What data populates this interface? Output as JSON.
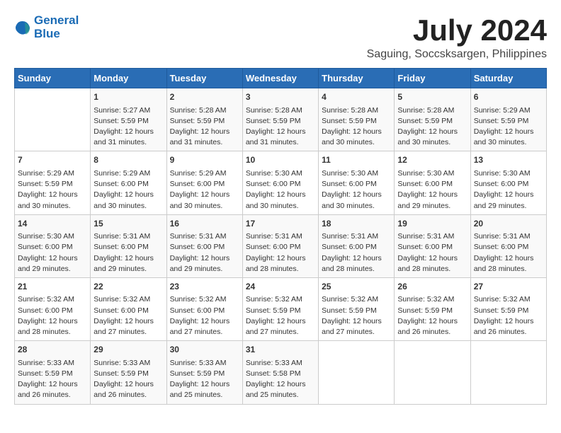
{
  "header": {
    "logo_line1": "General",
    "logo_line2": "Blue",
    "title": "July 2024",
    "location": "Saguing, Soccsksargen, Philippines"
  },
  "weekdays": [
    "Sunday",
    "Monday",
    "Tuesday",
    "Wednesday",
    "Thursday",
    "Friday",
    "Saturday"
  ],
  "weeks": [
    [
      {
        "day": "",
        "text": ""
      },
      {
        "day": "1",
        "text": "Sunrise: 5:27 AM\nSunset: 5:59 PM\nDaylight: 12 hours\nand 31 minutes."
      },
      {
        "day": "2",
        "text": "Sunrise: 5:28 AM\nSunset: 5:59 PM\nDaylight: 12 hours\nand 31 minutes."
      },
      {
        "day": "3",
        "text": "Sunrise: 5:28 AM\nSunset: 5:59 PM\nDaylight: 12 hours\nand 31 minutes."
      },
      {
        "day": "4",
        "text": "Sunrise: 5:28 AM\nSunset: 5:59 PM\nDaylight: 12 hours\nand 30 minutes."
      },
      {
        "day": "5",
        "text": "Sunrise: 5:28 AM\nSunset: 5:59 PM\nDaylight: 12 hours\nand 30 minutes."
      },
      {
        "day": "6",
        "text": "Sunrise: 5:29 AM\nSunset: 5:59 PM\nDaylight: 12 hours\nand 30 minutes."
      }
    ],
    [
      {
        "day": "7",
        "text": "Sunrise: 5:29 AM\nSunset: 5:59 PM\nDaylight: 12 hours\nand 30 minutes."
      },
      {
        "day": "8",
        "text": "Sunrise: 5:29 AM\nSunset: 6:00 PM\nDaylight: 12 hours\nand 30 minutes."
      },
      {
        "day": "9",
        "text": "Sunrise: 5:29 AM\nSunset: 6:00 PM\nDaylight: 12 hours\nand 30 minutes."
      },
      {
        "day": "10",
        "text": "Sunrise: 5:30 AM\nSunset: 6:00 PM\nDaylight: 12 hours\nand 30 minutes."
      },
      {
        "day": "11",
        "text": "Sunrise: 5:30 AM\nSunset: 6:00 PM\nDaylight: 12 hours\nand 30 minutes."
      },
      {
        "day": "12",
        "text": "Sunrise: 5:30 AM\nSunset: 6:00 PM\nDaylight: 12 hours\nand 29 minutes."
      },
      {
        "day": "13",
        "text": "Sunrise: 5:30 AM\nSunset: 6:00 PM\nDaylight: 12 hours\nand 29 minutes."
      }
    ],
    [
      {
        "day": "14",
        "text": "Sunrise: 5:30 AM\nSunset: 6:00 PM\nDaylight: 12 hours\nand 29 minutes."
      },
      {
        "day": "15",
        "text": "Sunrise: 5:31 AM\nSunset: 6:00 PM\nDaylight: 12 hours\nand 29 minutes."
      },
      {
        "day": "16",
        "text": "Sunrise: 5:31 AM\nSunset: 6:00 PM\nDaylight: 12 hours\nand 29 minutes."
      },
      {
        "day": "17",
        "text": "Sunrise: 5:31 AM\nSunset: 6:00 PM\nDaylight: 12 hours\nand 28 minutes."
      },
      {
        "day": "18",
        "text": "Sunrise: 5:31 AM\nSunset: 6:00 PM\nDaylight: 12 hours\nand 28 minutes."
      },
      {
        "day": "19",
        "text": "Sunrise: 5:31 AM\nSunset: 6:00 PM\nDaylight: 12 hours\nand 28 minutes."
      },
      {
        "day": "20",
        "text": "Sunrise: 5:31 AM\nSunset: 6:00 PM\nDaylight: 12 hours\nand 28 minutes."
      }
    ],
    [
      {
        "day": "21",
        "text": "Sunrise: 5:32 AM\nSunset: 6:00 PM\nDaylight: 12 hours\nand 28 minutes."
      },
      {
        "day": "22",
        "text": "Sunrise: 5:32 AM\nSunset: 6:00 PM\nDaylight: 12 hours\nand 27 minutes."
      },
      {
        "day": "23",
        "text": "Sunrise: 5:32 AM\nSunset: 6:00 PM\nDaylight: 12 hours\nand 27 minutes."
      },
      {
        "day": "24",
        "text": "Sunrise: 5:32 AM\nSunset: 5:59 PM\nDaylight: 12 hours\nand 27 minutes."
      },
      {
        "day": "25",
        "text": "Sunrise: 5:32 AM\nSunset: 5:59 PM\nDaylight: 12 hours\nand 27 minutes."
      },
      {
        "day": "26",
        "text": "Sunrise: 5:32 AM\nSunset: 5:59 PM\nDaylight: 12 hours\nand 26 minutes."
      },
      {
        "day": "27",
        "text": "Sunrise: 5:32 AM\nSunset: 5:59 PM\nDaylight: 12 hours\nand 26 minutes."
      }
    ],
    [
      {
        "day": "28",
        "text": "Sunrise: 5:33 AM\nSunset: 5:59 PM\nDaylight: 12 hours\nand 26 minutes."
      },
      {
        "day": "29",
        "text": "Sunrise: 5:33 AM\nSunset: 5:59 PM\nDaylight: 12 hours\nand 26 minutes."
      },
      {
        "day": "30",
        "text": "Sunrise: 5:33 AM\nSunset: 5:59 PM\nDaylight: 12 hours\nand 25 minutes."
      },
      {
        "day": "31",
        "text": "Sunrise: 5:33 AM\nSunset: 5:58 PM\nDaylight: 12 hours\nand 25 minutes."
      },
      {
        "day": "",
        "text": ""
      },
      {
        "day": "",
        "text": ""
      },
      {
        "day": "",
        "text": ""
      }
    ]
  ]
}
